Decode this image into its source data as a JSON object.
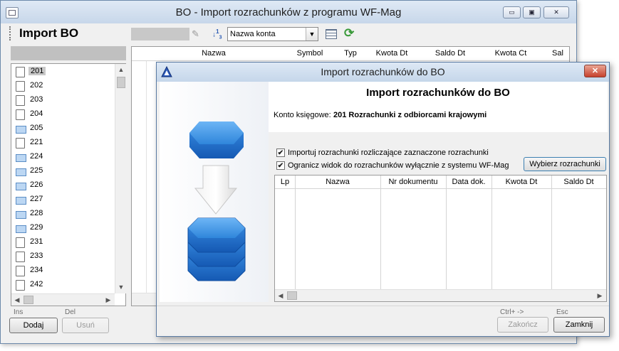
{
  "main_window": {
    "title": "BO - Import rozrachunków z programu WF-Mag",
    "heading": "Import BO",
    "sort_combo": "Nazwa konta",
    "caption_buttons": {
      "minimize": "▭",
      "maximize": "▣",
      "close": "✕"
    }
  },
  "tree": {
    "items": [
      {
        "label": "201",
        "type": "file",
        "selected": true
      },
      {
        "label": "202",
        "type": "file"
      },
      {
        "label": "203",
        "type": "file"
      },
      {
        "label": "204",
        "type": "file"
      },
      {
        "label": "205",
        "type": "folder"
      },
      {
        "label": "221",
        "type": "file"
      },
      {
        "label": "224",
        "type": "folder"
      },
      {
        "label": "225",
        "type": "folder"
      },
      {
        "label": "226",
        "type": "folder"
      },
      {
        "label": "227",
        "type": "folder"
      },
      {
        "label": "228",
        "type": "folder"
      },
      {
        "label": "229",
        "type": "folder"
      },
      {
        "label": "231",
        "type": "file"
      },
      {
        "label": "233",
        "type": "file"
      },
      {
        "label": "234",
        "type": "file"
      },
      {
        "label": "242",
        "type": "file"
      }
    ]
  },
  "bottom_left": {
    "shortcut_add": "Ins",
    "shortcut_remove": "Del",
    "add_label": "Dodaj",
    "remove_label": "Usuń"
  },
  "main_grid": {
    "columns": [
      "Nazwa",
      "Symbol",
      "Typ",
      "Kwota Dt",
      "Saldo Dt",
      "Kwota Ct",
      "Sal"
    ]
  },
  "dialog": {
    "title": "Import rozrachunków do BO",
    "heading": "Import rozrachunków do BO",
    "account_label": "Konto księgowe:",
    "account_value": "201 Rozrachunki z odbiorcami krajowymi",
    "checkbox1": {
      "label": "Importuj rozrachunki rozliczające zaznaczone rozrachunki",
      "checked": true
    },
    "checkbox2": {
      "label": "Ogranicz widok do rozrachunków wyłącznie z systemu WF-Mag",
      "checked": true
    },
    "select_button": "Wybierz rozrachunki",
    "grid_columns": [
      "Lp",
      "Nazwa",
      "Nr dokumentu",
      "Data dok.",
      "Kwota Dt",
      "Saldo Dt"
    ],
    "shortcut_finish": "Ctrl+ ->",
    "shortcut_close": "Esc",
    "finish_label": "Zakończ",
    "close_label": "Zamknij",
    "close_glyph": "✕"
  },
  "colors": {
    "db_blue": "#2b7fd8",
    "db_blue_dark": "#1759a8",
    "titlebar": "#c7d7ea"
  }
}
